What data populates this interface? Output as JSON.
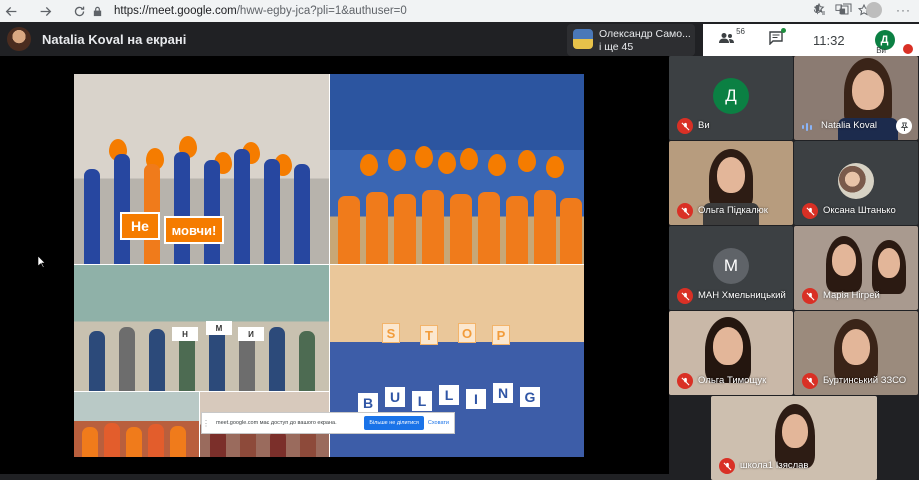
{
  "browser": {
    "url_host": "https://meet.google.com",
    "url_path": "/hww-egby-jca?pli=1&authuser=0"
  },
  "meet": {
    "presenter_title": "Natalia Koval на екрані",
    "active_speaker": {
      "name": "Олександр Само...",
      "more": "і ще 45"
    },
    "controls": {
      "people_count": "56",
      "time": "11:32",
      "self_initial": "Д",
      "self_label": "Ви"
    }
  },
  "collage": {
    "sign_ne": "Не",
    "sign_movchy": "мовчи!",
    "stop_letters": [
      "S",
      "T",
      "O",
      "P"
    ],
    "bulling_letters": [
      "B",
      "U",
      "L",
      "L",
      "I",
      "N",
      "G"
    ],
    "ne_mov_letters": [
      "Н",
      "М",
      "И"
    ]
  },
  "share_notice": {
    "text": "meet.google.com має доступ до вашого екрана.",
    "stop_label": "Більше не ділитися",
    "hide_label": "Сховати"
  },
  "participants": [
    {
      "name": "Ви",
      "initial": "Д",
      "color": "#0b8043",
      "muted": true
    },
    {
      "name": "Natalia Koval",
      "muted": false,
      "speaking": true
    },
    {
      "name": "Ольга Підкалюк",
      "muted": true
    },
    {
      "name": "Оксана Штанько",
      "muted": true
    },
    {
      "name": "МАН Хмельницький",
      "initial": "М",
      "color": "#5f6368",
      "muted": true
    },
    {
      "name": "Марія Нігрей",
      "muted": true
    },
    {
      "name": "Ольга Тимощук",
      "muted": true
    },
    {
      "name": "Буртинський ЗЗСО",
      "muted": true
    },
    {
      "name": "школа1 Ізяслав",
      "muted": true
    }
  ]
}
